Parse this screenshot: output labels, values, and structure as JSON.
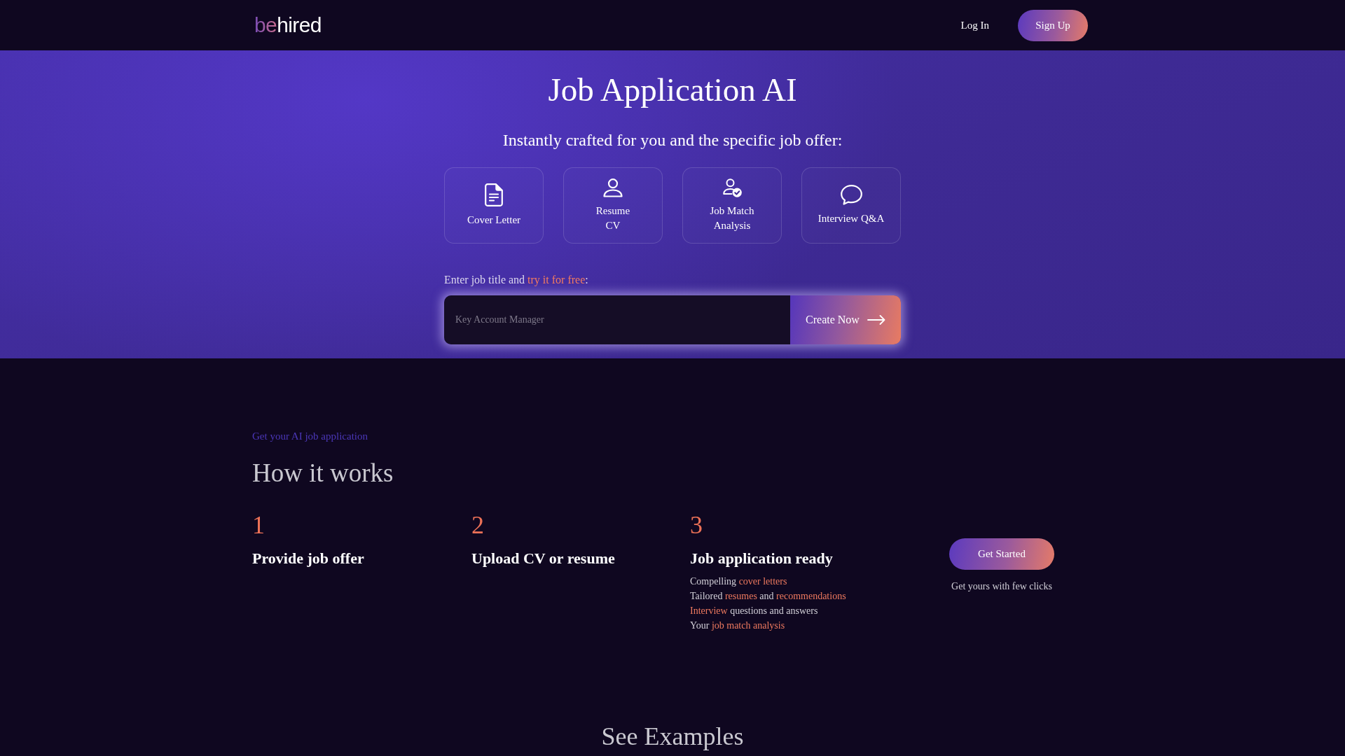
{
  "header": {
    "logo": {
      "accent": "be",
      "rest": "hired"
    },
    "login_link": "Log In",
    "signup_button": "Sign Up"
  },
  "hero": {
    "title": "Job Application AI",
    "subtitle": "Instantly crafted for you and the specific job offer:",
    "features": [
      {
        "kind": "letter",
        "label": "Cover Letter"
      },
      {
        "kind": "resume",
        "label": "Resume\nCV"
      },
      {
        "kind": "match",
        "label": "Job Match\nAnalysis"
      },
      {
        "kind": "interview",
        "label": "Interview Q&A"
      }
    ],
    "prompt": {
      "before": "Enter job title and ",
      "link": "try it for free",
      "after": ":"
    },
    "job_input": {
      "placeholder": "Key Account Manager"
    },
    "create_button": "Create Now"
  },
  "how_it_works": {
    "eyebrow": "Get your AI job application",
    "title": "How it works",
    "steps": [
      {
        "number": "1",
        "title": "Provide job offer"
      },
      {
        "number": "2",
        "title": "Upload CV or resume"
      },
      {
        "number": "3",
        "title": "Job application ready",
        "details": [
          {
            "segments": [
              {
                "text": "Compelling ",
                "highlight": false
              },
              {
                "text": "cover letters",
                "highlight": true
              }
            ]
          },
          {
            "segments": [
              {
                "text": "Tailored ",
                "highlight": false
              },
              {
                "text": "resumes",
                "highlight": true
              },
              {
                "text": " and ",
                "highlight": false
              },
              {
                "text": "recommendations",
                "highlight": true
              }
            ]
          },
          {
            "segments": [
              {
                "text": "Interview",
                "highlight": true
              },
              {
                "text": " questions and answers",
                "highlight": false
              }
            ]
          },
          {
            "segments": [
              {
                "text": "Your ",
                "highlight": false
              },
              {
                "text": "job match analysis",
                "highlight": true
              }
            ]
          }
        ]
      }
    ],
    "cta": {
      "button": "Get Started",
      "caption": "Get yours with few clicks"
    }
  },
  "examples": {
    "title": "See Examples"
  }
}
